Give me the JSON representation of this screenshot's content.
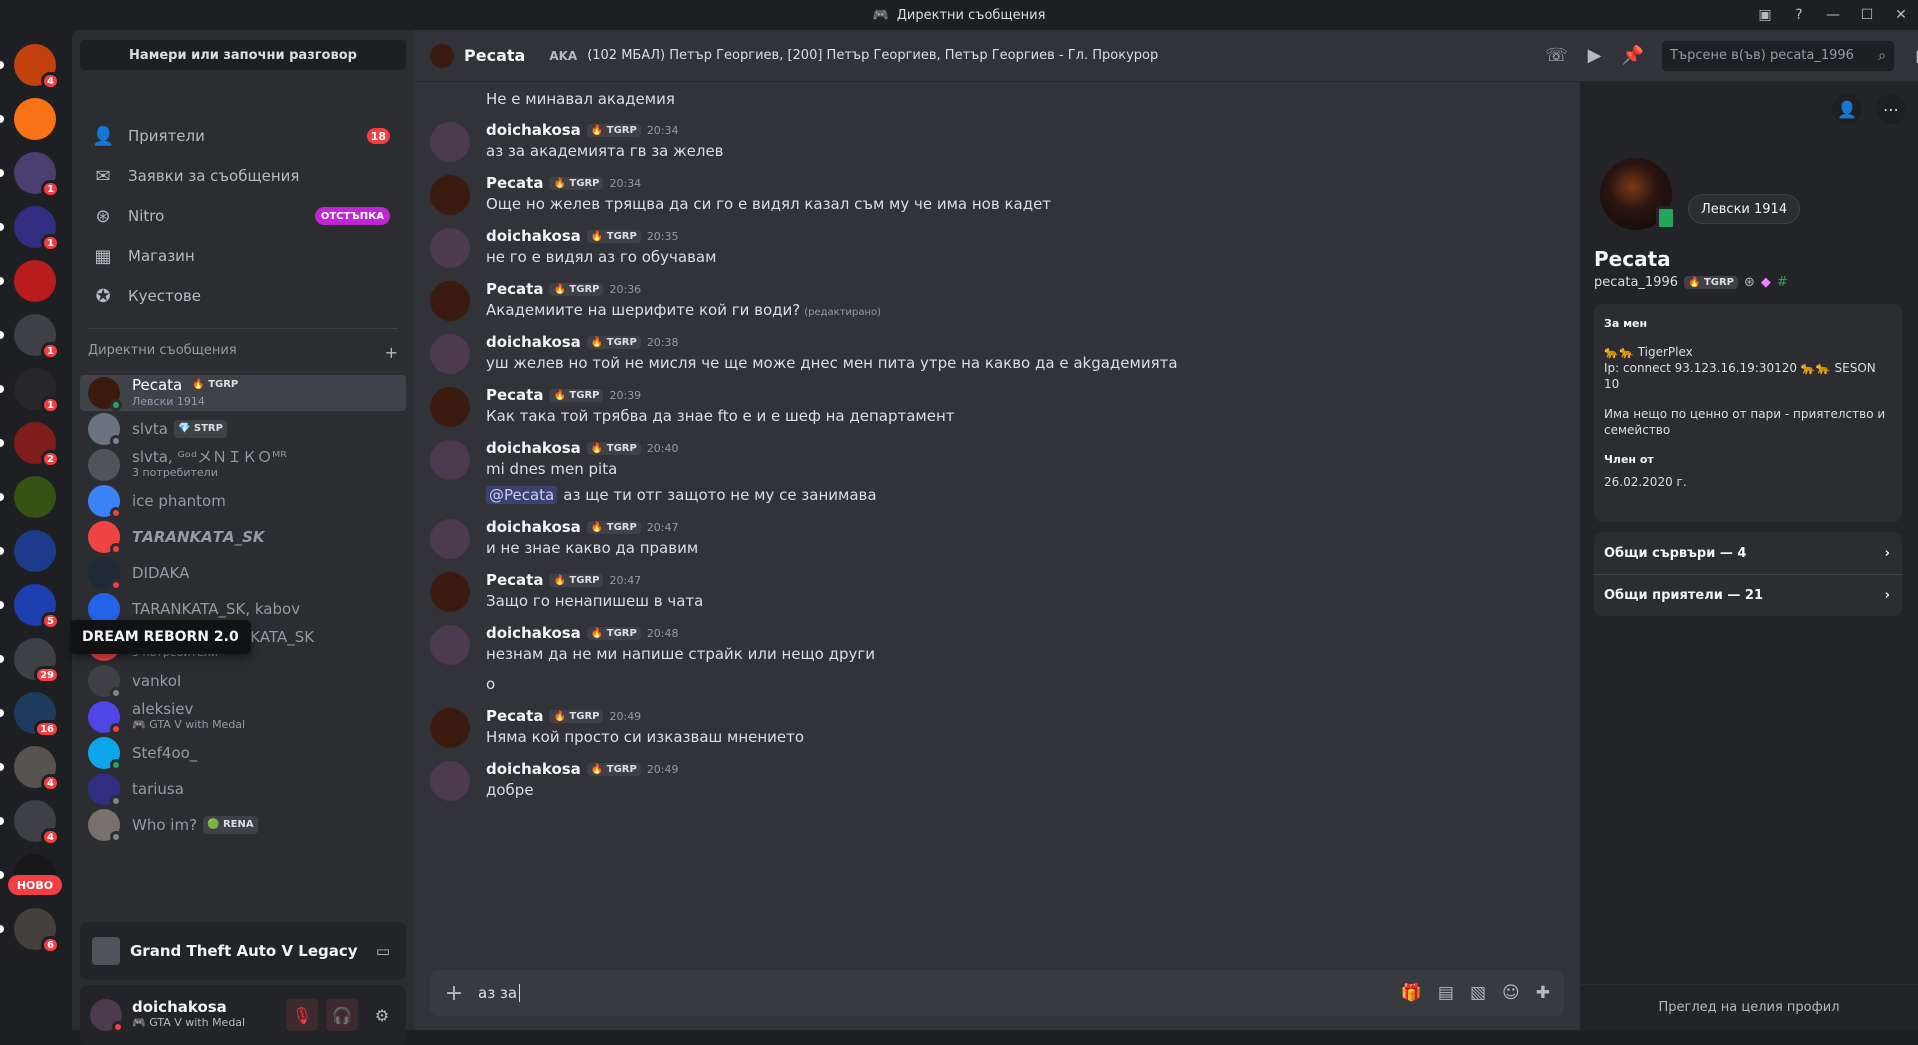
{
  "window": {
    "title": "Директни съобщения",
    "controls": [
      "inbox-icon",
      "help-icon",
      "minimize-icon",
      "maximize-icon",
      "close-icon"
    ]
  },
  "rail": {
    "tooltip": "DREAM REBORN 2.0",
    "new_label": "НОВО",
    "servers": [
      {
        "badge": "4",
        "color": "#c2410c"
      },
      {
        "badge": "",
        "color": "#f97316"
      },
      {
        "badge": "1",
        "color": "#4b3f72"
      },
      {
        "badge": "1",
        "color": "#312e81"
      },
      {
        "badge": "",
        "color": "#b91c1c"
      },
      {
        "badge": "1",
        "color": "#3f3f46"
      },
      {
        "badge": "1",
        "color": "#27272a"
      },
      {
        "badge": "2",
        "color": "#7f1d1d"
      },
      {
        "badge": "",
        "color": "#365314"
      },
      {
        "badge": "",
        "color": "#1e3a8a"
      },
      {
        "badge": "5",
        "color": "#1e40af"
      },
      {
        "badge": "29",
        "color": "#3f3f46"
      },
      {
        "badge": "16",
        "color": "#1e3a5f"
      },
      {
        "badge": "4",
        "color": "#57534e"
      },
      {
        "badge": "4",
        "color": "#3f3f46"
      },
      {
        "badge": "",
        "color": "#18181b"
      },
      {
        "badge": "6",
        "color": "#44403c"
      }
    ]
  },
  "dm": {
    "search": "Намери или започни разговор",
    "nav": [
      {
        "label": "Приятели",
        "icon": "friends-icon",
        "badge": "18"
      },
      {
        "label": "Заявки за съобщения",
        "icon": "mail-icon",
        "badge": ""
      },
      {
        "label": "Nitro",
        "icon": "nitro-icon",
        "tag": "ОТСТЪПКА"
      },
      {
        "label": "Магазин",
        "icon": "shop-icon",
        "badge": ""
      },
      {
        "label": "Куестове",
        "icon": "quests-icon",
        "badge": ""
      }
    ],
    "header": "Директни съобщения",
    "add": "+",
    "conversations": [
      {
        "name": "Pecata",
        "tag": "🔥 TGRP",
        "sub": "Левски 1914",
        "active": true,
        "status": "#23a55a",
        "color": "#3b1a10"
      },
      {
        "name": "slvta",
        "tag": "💎 STRP",
        "sub": "",
        "status": "#80848e",
        "color": "#6b7280"
      },
      {
        "name": "slvta, ᴳᵒᵈメＮＩＫＯᴹᴿ",
        "tag": "",
        "sub": "3 потребители",
        "status": "",
        "color": "#52525b"
      },
      {
        "name": "ice phantom",
        "tag": "",
        "sub": "",
        "status": "#f23f43",
        "color": "#3b82f6"
      },
      {
        "name": "𝙏𝘼𝙍𝘼𝙉𝙆𝘼𝙏𝘼_𝙎𝙆",
        "tag": "",
        "sub": "",
        "status": "#f23f43",
        "color": "#ef4444"
      },
      {
        "name": "DIDAKA",
        "tag": "",
        "sub": "",
        "status": "#f23f43",
        "color": "#1f2937"
      },
      {
        "name": "TARANKATA_SK, kabov",
        "tag": "",
        "sub": "",
        "status": "",
        "color": "#2563eb"
      },
      {
        "name": "?!𝓈𝓁𝓋𝓉𝒶?!, TARANKATA_SK",
        "tag": "",
        "sub": "3 потребители",
        "status": "",
        "color": "#ef4444"
      },
      {
        "name": "vankoI",
        "tag": "",
        "sub": "",
        "status": "#80848e",
        "color": "#3f3f46"
      },
      {
        "name": "aleksiev",
        "tag": "",
        "sub": "🎮 GTA V with Medal",
        "status": "#f23f43",
        "color": "#4f46e5"
      },
      {
        "name": "Stef4oo_",
        "tag": "",
        "sub": "",
        "status": "#23a55a",
        "color": "#0ea5e9"
      },
      {
        "name": "tariusa",
        "tag": "",
        "sub": "",
        "status": "#80848e",
        "color": "#312e81"
      },
      {
        "name": "Who im?",
        "tag": "🟢 RENA",
        "sub": "",
        "status": "#80848e",
        "color": "#78716c"
      }
    ],
    "game": "Grand Theft Auto V Legacy",
    "user": {
      "name": "doichakosa",
      "status": "🎮 GTA V with Medal"
    }
  },
  "chat": {
    "header": {
      "name": "Pecata",
      "aka_label": "AKA",
      "aka": "(102 МБАЛ) Петър Георгиев, [200] Петър Георгиев, Петър Георгиев - Гл. Прокурор",
      "search_placeholder": "Търсене в(ъв) pecata_1996"
    },
    "top_line": "Не е минавал академия",
    "messages": [
      {
        "author": "doichakosa",
        "tag": "🔥 TGRP",
        "time": "20:34",
        "lines": [
          "аз за академията гв за желев"
        ],
        "color": "#4c3a4f"
      },
      {
        "author": "Pecata",
        "tag": "🔥 TGRP",
        "time": "20:34",
        "lines": [
          "Още но желев трящва да си го е видял казал съм му че има нов кадет"
        ],
        "color": "#3b1a10"
      },
      {
        "author": "doichakosa",
        "tag": "🔥 TGRP",
        "time": "20:35",
        "lines": [
          "не го е видял аз го обучавам"
        ],
        "color": "#4c3a4f"
      },
      {
        "author": "Pecata",
        "tag": "🔥 TGRP",
        "time": "20:36",
        "lines": [
          "Академиите на шерифите кой ги води?"
        ],
        "edited": "(редактирано)",
        "color": "#3b1a10"
      },
      {
        "author": "doichakosa",
        "tag": "🔥 TGRP",
        "time": "20:38",
        "lines": [
          "уш желев но той не мисля че ще може днес мен пита утре на какво да е akgaдемията"
        ],
        "color": "#4c3a4f"
      },
      {
        "author": "Pecata",
        "tag": "🔥 TGRP",
        "time": "20:39",
        "lines": [
          "Как така той трябва да знае fto е и е шеф на департамент"
        ],
        "color": "#3b1a10"
      },
      {
        "author": "doichakosa",
        "tag": "🔥 TGRP",
        "time": "20:40",
        "lines": [
          "mi dnes men pita"
        ],
        "mention": "@Pecata",
        "mention_line": "аз ще ти отг защото не му се занимава",
        "color": "#4c3a4f"
      },
      {
        "author": "doichakosa",
        "tag": "🔥 TGRP",
        "time": "20:47",
        "lines": [
          "и не знае какво да правим"
        ],
        "color": "#4c3a4f"
      },
      {
        "author": "Pecata",
        "tag": "🔥 TGRP",
        "time": "20:47",
        "lines": [
          "Защо го ненапишеш в чата"
        ],
        "color": "#3b1a10"
      },
      {
        "author": "doichakosa",
        "tag": "🔥 TGRP",
        "time": "20:48",
        "lines": [
          "незнам да не ми напише страйк или нещо други",
          "о"
        ],
        "color": "#4c3a4f"
      },
      {
        "author": "Pecata",
        "tag": "🔥 TGRP",
        "time": "20:49",
        "lines": [
          "Няма кой просто си изказваш мнението"
        ],
        "color": "#3b1a10"
      },
      {
        "author": "doichakosa",
        "tag": "🔥 TGRP",
        "time": "20:49",
        "lines": [
          "добре"
        ],
        "color": "#4c3a4f"
      }
    ],
    "composer_text": "аз за"
  },
  "profile": {
    "custom_status": "Левски 1914",
    "display_name": "Pecata",
    "username": "pecata_1996",
    "tag": "🔥 TGRP",
    "about_header": "За мен",
    "about_1": "🐆🐆 TigerPlex",
    "about_2": "Ip: connect 93.123.16.19:30120 🐆🐆 SESON 10",
    "about_3": "Има нещо по ценно от пари - приятелство и семейство",
    "member_header": "Член от",
    "member_since": "26.02.2020 г.",
    "mutual_servers": "Общи сървъри — 4",
    "mutual_friends": "Общи приятели — 21",
    "footer": "Преглед на целия профил"
  },
  "colors": {
    "accent": "#5865f2",
    "danger": "#f23f43",
    "online": "#23a55a"
  }
}
